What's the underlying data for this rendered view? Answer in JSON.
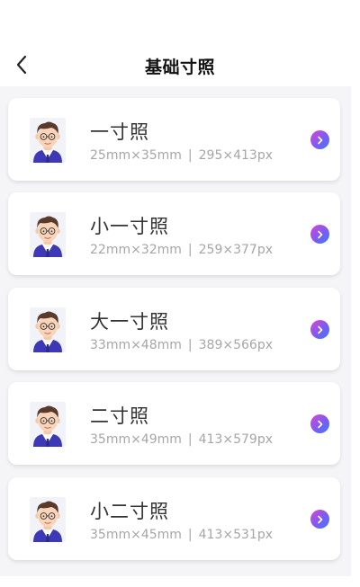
{
  "header": {
    "title": "基础寸照",
    "back_icon": "chevron-left-icon"
  },
  "colors": {
    "accent_gradient": [
      "#e043d6",
      "#7a5cf0",
      "#3a7cff"
    ],
    "title_text": "#333333",
    "spec_text": "#a6a6a6",
    "page_bg": "#f5f5f7"
  },
  "items": [
    {
      "name": "一寸照",
      "mm": "25mm×35mm",
      "px": "295×413px",
      "avatar_icon": "person-avatar-icon",
      "arrow_icon": "chevron-right-circle-icon"
    },
    {
      "name": "小一寸照",
      "mm": "22mm×32mm",
      "px": "259×377px",
      "avatar_icon": "person-avatar-icon",
      "arrow_icon": "chevron-right-circle-icon"
    },
    {
      "name": "大一寸照",
      "mm": "33mm×48mm",
      "px": "389×566px",
      "avatar_icon": "person-avatar-icon",
      "arrow_icon": "chevron-right-circle-icon"
    },
    {
      "name": "二寸照",
      "mm": "35mm×49mm",
      "px": "413×579px",
      "avatar_icon": "person-avatar-icon",
      "arrow_icon": "chevron-right-circle-icon"
    },
    {
      "name": "小二寸照",
      "mm": "35mm×45mm",
      "px": "413×531px",
      "avatar_icon": "person-avatar-icon",
      "arrow_icon": "chevron-right-circle-icon"
    }
  ]
}
